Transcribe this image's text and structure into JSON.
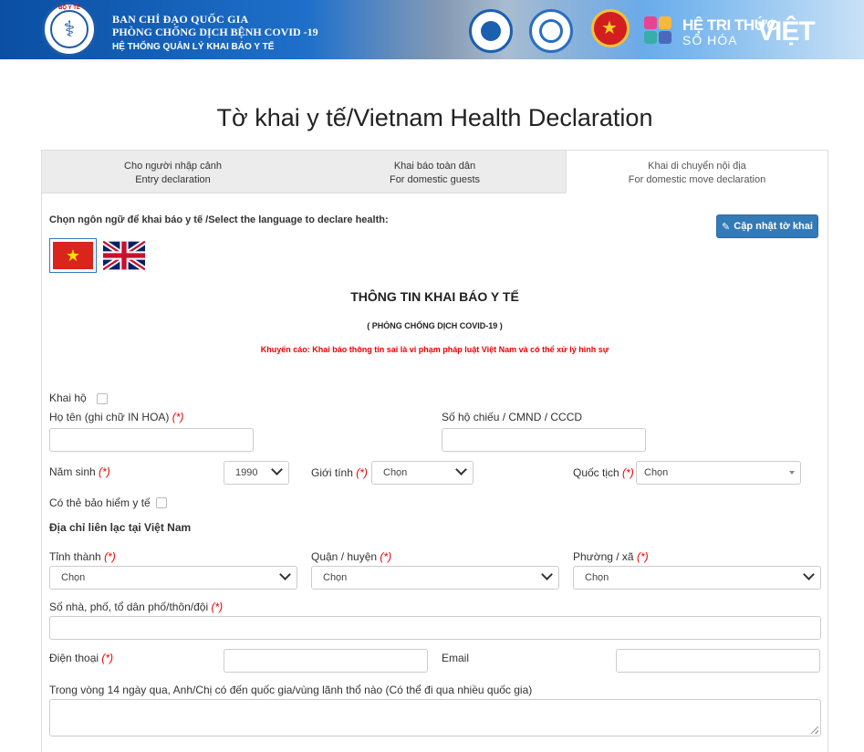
{
  "header": {
    "moh_logo_text": "BỘ Y TẾ",
    "line1": "BAN CHỈ ĐẠO QUỐC GIA",
    "line2": "PHÒNG CHỐNG DỊCH BỆNH COVID -19",
    "line3": "HỆ THỐNG QUẢN LÝ KHAI BÁO Y TẾ",
    "partner_title": "HỆ TRI THỨC",
    "partner_sub": "SỐ HÓA",
    "partner_big": "VIỆT"
  },
  "page_title": "Tờ khai y tế/Vietnam Health Declaration",
  "tabs": [
    {
      "line1": "Cho người nhập cảnh",
      "line2": "Entry declaration"
    },
    {
      "line1": "Khai báo toàn dân",
      "line2": "For domestic guests"
    },
    {
      "line1": "Khai di chuyển nội địa",
      "line2": "For domestic move declaration"
    }
  ],
  "lang_label": "Chọn ngôn ngữ để khai báo y tế /Select the language to declare health:",
  "update_button": "Cập nhật tờ khai",
  "form": {
    "title": "THÔNG TIN KHAI BÁO Y TẾ",
    "subtitle": "( PHÒNG CHỐNG DỊCH COVID-19 )",
    "warning": "Khuyến cáo: Khai báo thông tin sai là vi phạm pháp luật Việt Nam và có thể xử lý hình sự",
    "required_mark": "(*)",
    "proxy_label": "Khai hộ",
    "fullname_label": "Họ tên (ghi chữ IN HOA)",
    "id_label": "Số hộ chiếu / CMND / CCCD",
    "birth_year_label": "Năm sinh",
    "birth_year_value": "1990",
    "gender_label": "Giới tính",
    "gender_value": "Chọn",
    "nationality_label": "Quốc tịch",
    "nationality_value": "Chọn",
    "insurance_label": "Có thẻ bảo hiểm y tế",
    "address_section": "Địa chỉ liên lạc tại Việt Nam",
    "province_label": "Tỉnh thành",
    "province_value": "Chọn",
    "district_label": "Quận / huyện",
    "district_value": "Chọn",
    "ward_label": "Phường / xã",
    "ward_value": "Chọn",
    "street_label": "Số nhà, phố, tổ dân phố/thôn/đội",
    "phone_label": "Điện thoại",
    "email_label": "Email",
    "travel_label": "Trong vòng 14 ngày qua, Anh/Chị có đến quốc gia/vùng lãnh thổ nào (Có thể đi qua nhiều quốc gia)"
  }
}
